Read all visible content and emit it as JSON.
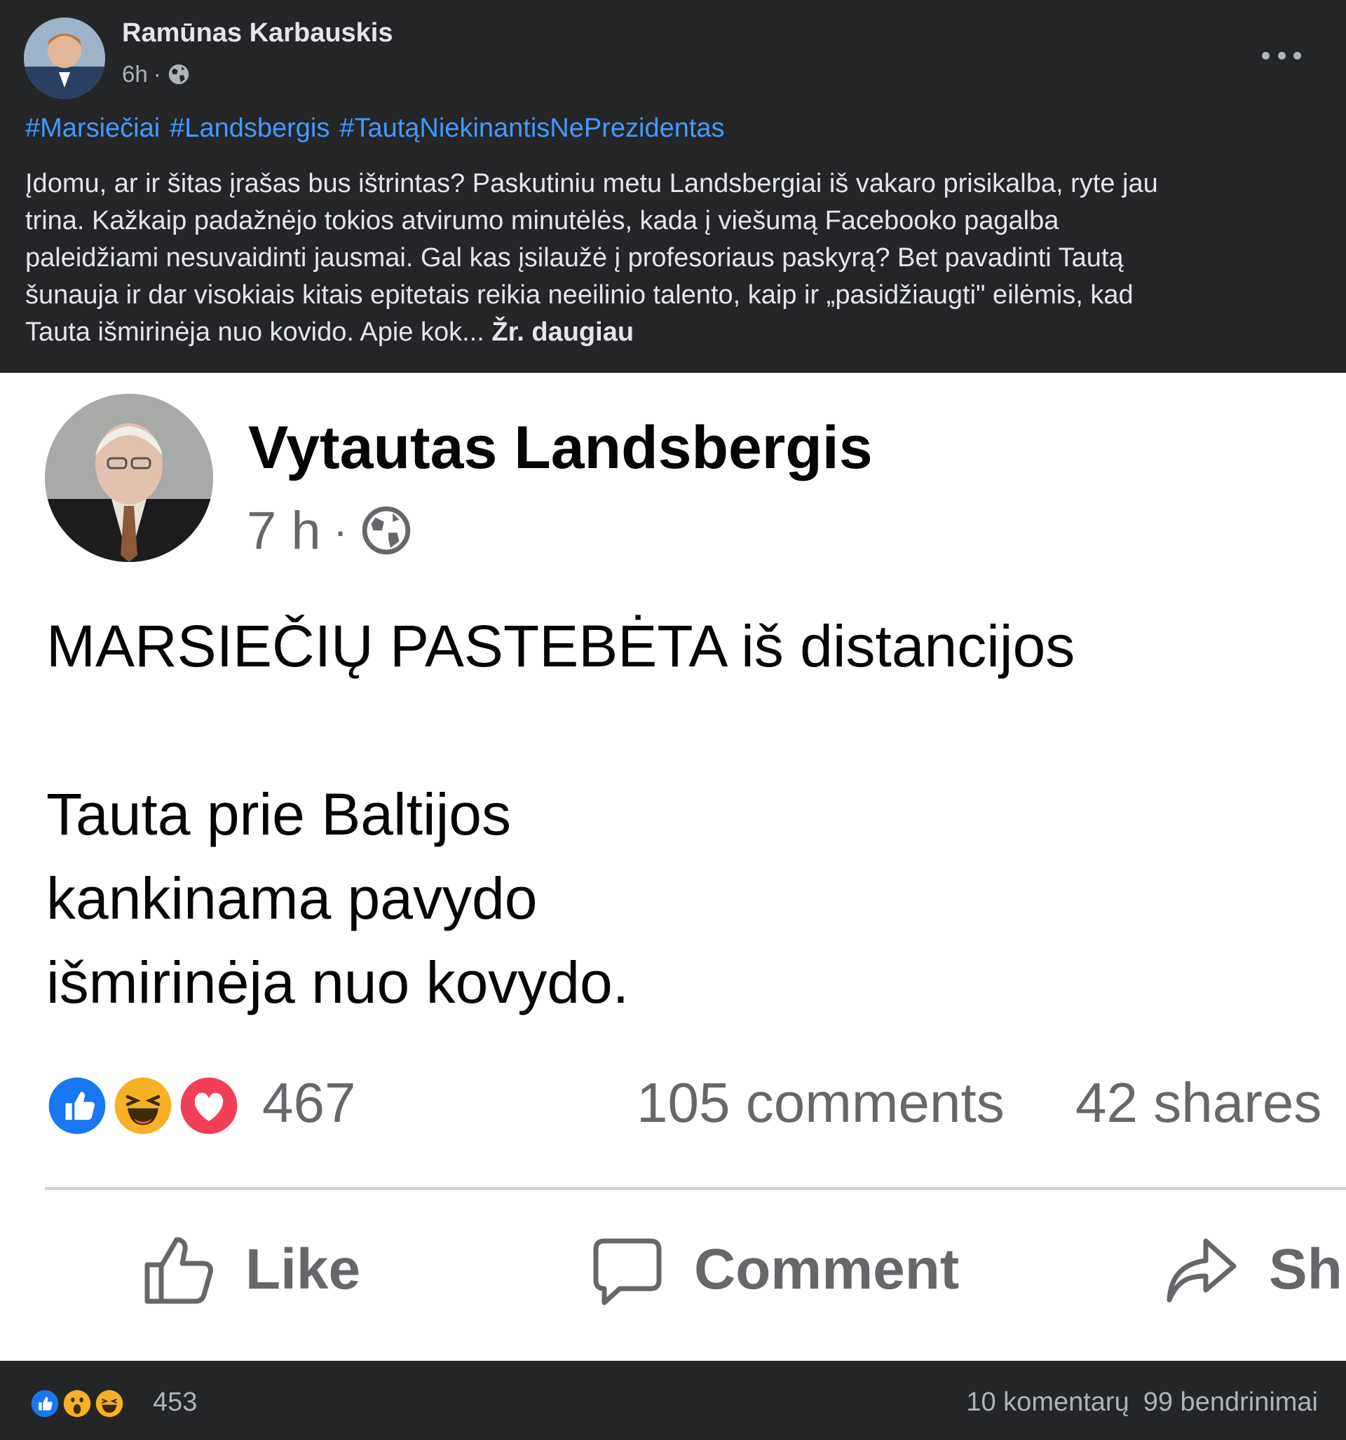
{
  "top_post": {
    "author": "Ramūnas Karbauskis",
    "time": "6h",
    "separator": "·",
    "more_icon": "ellipsis-icon",
    "hashtags": [
      "#Marsiečiai",
      "#Landsbergis",
      "#TautąNiekinantisNePrezidentas"
    ],
    "body_lines": [
      "Įdomu, ar ir šitas įrašas bus ištrintas? Paskutiniu metu Landsbergiai iš vakaro prisikalba, ryte jau",
      "trina. Kažkaip padažnėjo tokios atvirumo minutėlės, kada į viešumą Facebooko pagalba",
      "paleidžiami nesuvaidinti jausmai. Gal kas įsilaužė į profesoriaus paskyrą? Bet pavadinti Tautą",
      "šunauja ir dar visokiais kitais epitetais reikia neeilinio talento, kaip ir „pasidžiaugti\" eilėmis, kad",
      "Tauta išmirinėja nuo kovido. Apie kok..."
    ],
    "see_more": "Žr. daugiau"
  },
  "embedded_post": {
    "author": "Vytautas Landsbergis",
    "time": "7 h",
    "separator": "·",
    "text_lines": [
      "MARSIEČIŲ PASTEBĖTA iš distancijos",
      "",
      "Tauta prie Baltijos",
      "kankinama pavydo",
      "išmirinėja nuo kovydo."
    ],
    "reaction_count": "467",
    "comments": "105 comments",
    "shares": "42 shares",
    "actions": {
      "like": "Like",
      "comment": "Comment",
      "share": "Sh"
    }
  },
  "bottom_bar": {
    "reaction_count": "453",
    "comments": "10 komentarų",
    "shares": "99 bendrinimai"
  },
  "colors": {
    "dark_bg": "#242526",
    "hashtag_blue": "#4599ff",
    "like_blue": "#1877f2",
    "love_red": "#f33e58",
    "haha_yellow": "#f7b125"
  }
}
